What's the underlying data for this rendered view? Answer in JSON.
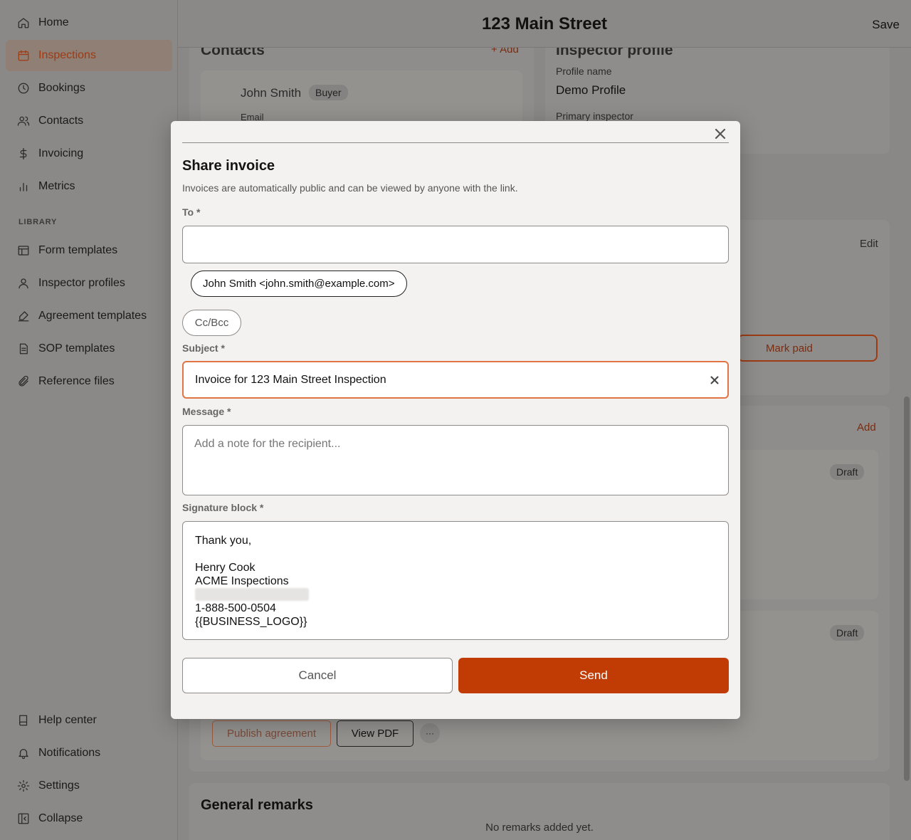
{
  "sidebar": {
    "items": [
      {
        "label": "Home",
        "icon": "home-icon"
      },
      {
        "label": "Inspections",
        "icon": "calendar-icon"
      },
      {
        "label": "Bookings",
        "icon": "clock-icon"
      },
      {
        "label": "Contacts",
        "icon": "users-icon"
      },
      {
        "label": "Invoicing",
        "icon": "dollar-icon"
      },
      {
        "label": "Metrics",
        "icon": "bar-chart-icon"
      }
    ],
    "section_label": "LIBRARY",
    "library": [
      {
        "label": "Form templates",
        "icon": "layout-icon"
      },
      {
        "label": "Inspector profiles",
        "icon": "user-icon"
      },
      {
        "label": "Agreement templates",
        "icon": "signature-icon"
      },
      {
        "label": "SOP templates",
        "icon": "file-icon"
      },
      {
        "label": "Reference files",
        "icon": "paperclip-icon"
      }
    ],
    "bottom": [
      {
        "label": "Help center",
        "icon": "book-icon"
      },
      {
        "label": "Notifications",
        "icon": "bell-icon"
      },
      {
        "label": "Settings",
        "icon": "gear-icon"
      },
      {
        "label": "Collapse",
        "icon": "collapse-icon"
      }
    ]
  },
  "header": {
    "title": "123 Main Street",
    "save_label": "Save"
  },
  "background": {
    "contacts_title": "Contacts",
    "contacts_add": "+ Add",
    "contact_name": "John Smith",
    "contact_role": "Buyer",
    "contact_email_label": "Email",
    "inspector_title": "Inspector profile",
    "profile_name_label": "Profile name",
    "profile_name_value": "Demo Profile",
    "primary_inspector_label": "Primary inspector",
    "edit_label": "Edit",
    "mark_paid_label": "Mark paid",
    "add_label": "Add",
    "draft_1": "Draft",
    "draft_2": "Draft",
    "publish_agreement": "Publish agreement",
    "view_pdf": "View PDF",
    "more": "···",
    "remarks_title": "General remarks",
    "remarks_empty": "No remarks added yet."
  },
  "modal": {
    "title": "Share invoice",
    "subtitle": "Invoices are automatically public and can be viewed by anyone with the link.",
    "to_label": "To *",
    "to_value": "",
    "recipient_chip": "John Smith <john.smith@example.com>",
    "ccbcc_label": "Cc/Bcc",
    "subject_label": "Subject *",
    "subject_value": "Invoice for 123 Main Street Inspection",
    "message_label": "Message *",
    "message_placeholder": "Add a note for the recipient...",
    "signature_label": "Signature block *",
    "signature": {
      "line1": "Thank you,",
      "name": "Henry Cook",
      "company": "ACME Inspections",
      "phone": "1-888-500-0504",
      "logo": "{{BUSINESS_LOGO}}"
    },
    "cancel_label": "Cancel",
    "send_label": "Send"
  },
  "colors": {
    "accent": "#c13c04",
    "focus": "#e07445",
    "active_nav": "#a03a12"
  }
}
